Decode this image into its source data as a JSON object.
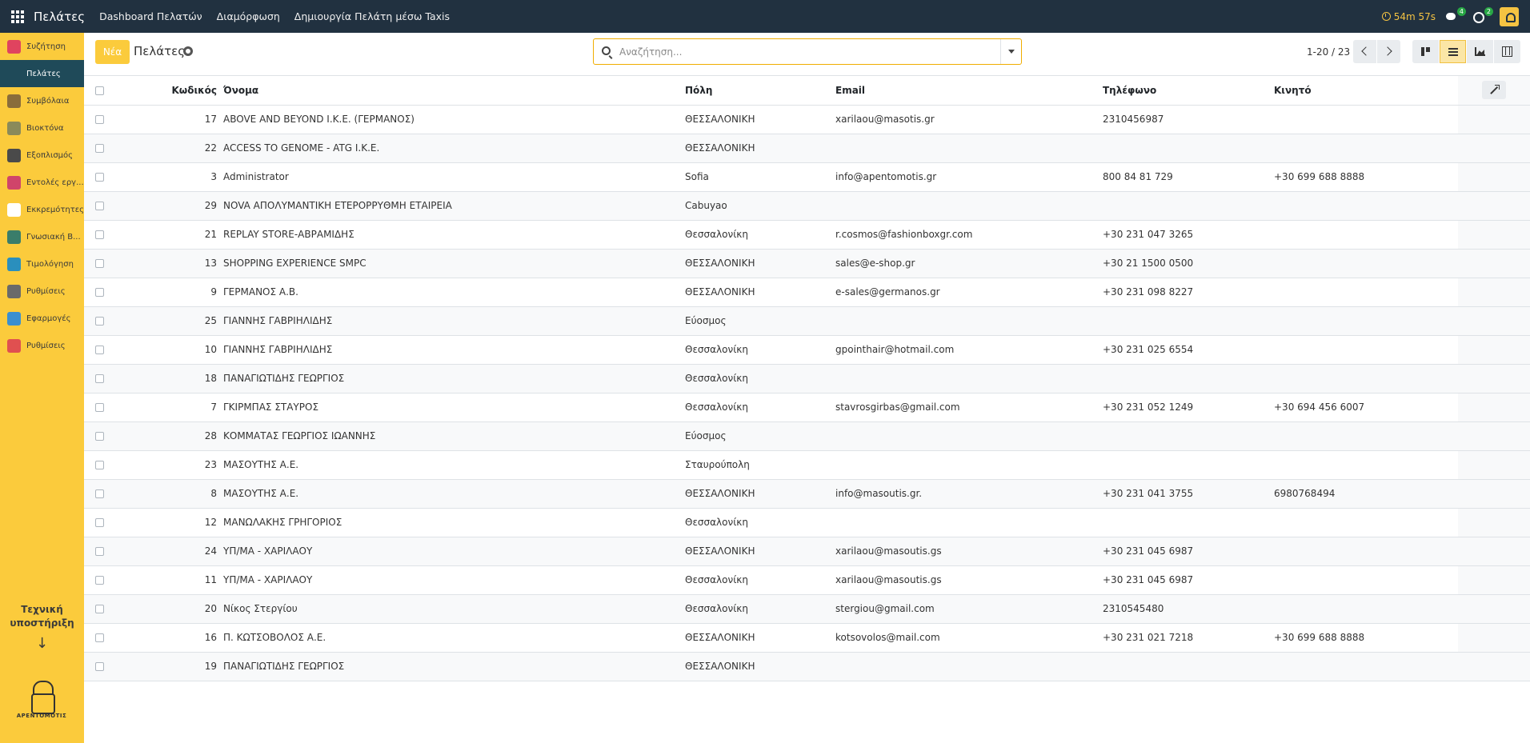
{
  "app": {
    "title": "Πελάτες",
    "menu": [
      "Dashboard Πελατών",
      "Διαμόρφωση",
      "Δημιουργία Πελάτη μέσω Taxis"
    ]
  },
  "systray": {
    "timer": "54m 57s",
    "messages_count": "4",
    "activities_count": "2"
  },
  "sidebar": {
    "items": [
      {
        "label": "Συζήτηση",
        "icon": "chat-icon",
        "color": "#e0435f"
      },
      {
        "label": "Πελάτες",
        "icon": "users-icon",
        "color": "#1f4a59"
      },
      {
        "label": "Συμβόλαια",
        "icon": "contract-icon",
        "color": "#8a6d3b"
      },
      {
        "label": "Βιοκτόνα",
        "icon": "biocide-icon",
        "color": "#8a8a5a"
      },
      {
        "label": "Εξοπλισμός",
        "icon": "equipment-icon",
        "color": "#4a4a4a"
      },
      {
        "label": "Εντολές εργ...",
        "icon": "work-order-icon",
        "color": "#d0446a"
      },
      {
        "label": "Εκκρεμότητες",
        "icon": "pencil-icon",
        "color": "#ffffff"
      },
      {
        "label": "Γνωσιακή Β...",
        "icon": "knowledge-icon",
        "color": "#3a7d6a"
      },
      {
        "label": "Τιμολόγηση",
        "icon": "invoice-icon",
        "color": "#2a8fbd"
      },
      {
        "label": "Ρυθμίσεις",
        "icon": "settings-icon",
        "color": "#6a6a6a"
      },
      {
        "label": "Εφαρμογές",
        "icon": "apps-multicolor-icon",
        "color": "#3a8fd0"
      },
      {
        "label": "Ρυθμίσεις",
        "icon": "settings-dial-icon",
        "color": "#e05050"
      }
    ],
    "support_line1": "Τεχνική",
    "support_line2": "υποστήριξη",
    "support_arrow": "↓",
    "logo_text": "ΑΡΕΝΤΟΜΟΤΙΣ"
  },
  "control": {
    "new_label": "Νέα",
    "breadcrumb": "Πελάτες",
    "search_placeholder": "Αναζήτηση...",
    "pager": "1-20 / 23"
  },
  "table": {
    "headers": {
      "code": "Κωδικός",
      "name": "Όνομα",
      "city": "Πόλη",
      "email": "Email",
      "phone": "Τηλέφωνο",
      "mobile": "Κινητό"
    },
    "rows": [
      {
        "code": "17",
        "name": "ABOVE AND BEYOND I.K.E. (ΓΕΡΜΑΝΟΣ)",
        "city": "ΘΕΣΣΑΛΟΝΙΚΗ",
        "email": "xarilaou@masotis.gr",
        "phone": "2310456987",
        "mobile": ""
      },
      {
        "code": "22",
        "name": "ACCESS TO GENOME - ATG I.K.E.",
        "city": "ΘΕΣΣΑΛΟΝΙΚΗ",
        "email": "",
        "phone": "",
        "mobile": ""
      },
      {
        "code": "3",
        "name": "Administrator",
        "city": "Sofia",
        "email": "info@apentomotis.gr",
        "phone": "800 84 81 729",
        "mobile": "+30 699 688 8888"
      },
      {
        "code": "29",
        "name": "NOVA ΑΠΟΛΥΜΑΝΤΙΚΗ ΕΤΕΡΟΡΡΥΘΜΗ ΕΤΑΙΡΕΙΑ",
        "city": "Cabuyao",
        "email": "",
        "phone": "",
        "mobile": ""
      },
      {
        "code": "21",
        "name": "REPLAY STORE-ΑΒΡΑΜΙΔΗΣ",
        "city": "Θεσσαλονίκη",
        "email": "r.cosmos@fashionboxgr.com",
        "phone": "+30 231 047 3265",
        "mobile": ""
      },
      {
        "code": "13",
        "name": "SHOPPING EXPERIENCE SMPC",
        "city": "ΘΕΣΣΑΛΟΝΙΚΗ",
        "email": "sales@e-shop.gr",
        "phone": "+30 21 1500 0500",
        "mobile": ""
      },
      {
        "code": "9",
        "name": "ΓΕΡΜΑΝΟΣ Α.Β.",
        "city": "ΘΕΣΣΑΛΟΝΙΚΗ",
        "email": "e-sales@germanos.gr",
        "phone": "+30 231 098 8227",
        "mobile": ""
      },
      {
        "code": "25",
        "name": "ΓΙΑΝΝΗΣ ΓΑΒΡΙΗΛΙΔΗΣ",
        "city": "Εύοσμος",
        "email": "",
        "phone": "",
        "mobile": ""
      },
      {
        "code": "10",
        "name": "ΓΙΑΝΝΗΣ ΓΑΒΡΙΗΛΙΔΗΣ",
        "city": "Θεσσαλονίκη",
        "email": "gpointhair@hotmail.com",
        "phone": "+30 231 025 6554",
        "mobile": ""
      },
      {
        "code": "18",
        "name": "ΠΑΝΑΓΙΩΤΙΔΗΣ ΓΕΩΡΓΙΟΣ",
        "city": "Θεσσαλονίκη",
        "email": "",
        "phone": "",
        "mobile": ""
      },
      {
        "code": "7",
        "name": "ΓΚΙΡΜΠΑΣ ΣΤΑΥΡΟΣ",
        "city": "Θεσσαλονίκη",
        "email": "stavrosgirbas@gmail.com",
        "phone": "+30 231 052 1249",
        "mobile": "+30 694 456 6007"
      },
      {
        "code": "28",
        "name": "ΚΟΜΜΑΤΑΣ ΓΕΩΡΓΙΟΣ ΙΩΑΝΝΗΣ",
        "city": "Εύοσμος",
        "email": "",
        "phone": "",
        "mobile": ""
      },
      {
        "code": "23",
        "name": "ΜΑΣΟΥΤΗΣ Α.Ε.",
        "city": "Σταυρούπολη",
        "email": "",
        "phone": "",
        "mobile": ""
      },
      {
        "code": "8",
        "name": "ΜΑΣΟΥΤΗΣ Α.Ε.",
        "city": "ΘΕΣΣΑΛΟΝΙΚΗ",
        "email": "info@masoutis.gr.",
        "phone": "+30 231 041 3755",
        "mobile": "6980768494"
      },
      {
        "code": "12",
        "name": "ΜΑΝΩΛΑΚΗΣ ΓΡΗΓΟΡΙΟΣ",
        "city": "Θεσσαλονίκη",
        "email": "",
        "phone": "",
        "mobile": ""
      },
      {
        "code": "24",
        "name": "ΥΠ/ΜΑ - ΧΑΡΙΛΑΟΥ",
        "city": "ΘΕΣΣΑΛΟΝΙΚΗ",
        "email": "xarilaou@masoutis.gs",
        "phone": "+30 231 045 6987",
        "mobile": ""
      },
      {
        "code": "11",
        "name": "ΥΠ/ΜΑ - ΧΑΡΙΛΑΟΥ",
        "city": "Θεσσαλονίκη",
        "email": "xarilaou@masoutis.gs",
        "phone": "+30 231 045 6987",
        "mobile": ""
      },
      {
        "code": "20",
        "name": "Νίκος Στεργίου",
        "city": "Θεσσαλονίκη",
        "email": "stergiou@gmail.com",
        "phone": "2310545480",
        "mobile": ""
      },
      {
        "code": "16",
        "name": "Π. ΚΩΤΣΟΒΟΛΟΣ Α.Ε.",
        "city": "ΘΕΣΣΑΛΟΝΙΚΗ",
        "email": "kotsovolos@mail.com",
        "phone": "+30 231 021 7218",
        "mobile": "+30 699 688 8888"
      },
      {
        "code": "19",
        "name": "ΠΑΝΑΓΙΩΤΙΔΗΣ ΓΕΩΡΓΙΟΣ",
        "city": "ΘΕΣΣΑΛΟΝΙΚΗ",
        "email": "",
        "phone": "",
        "mobile": ""
      }
    ]
  }
}
